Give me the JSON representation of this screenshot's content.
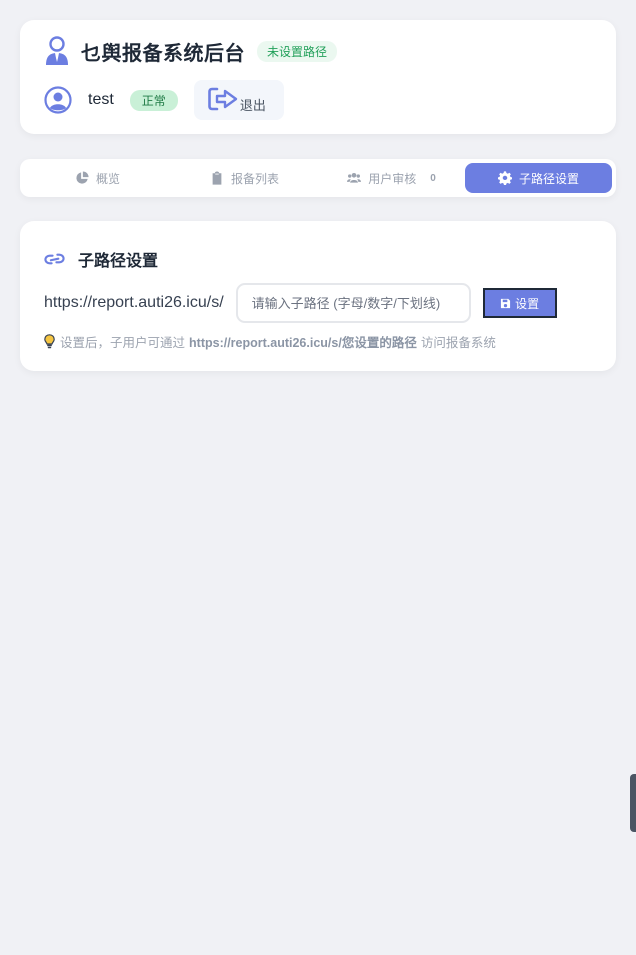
{
  "header": {
    "app_title": "乜舆报备系统后台",
    "path_badge": "未设置路径",
    "username": "test",
    "status": "正常",
    "logout_label": "退出"
  },
  "tabs": [
    {
      "label": "概览",
      "icon": "chart-pie-icon"
    },
    {
      "label": "报备列表",
      "icon": "clipboard-icon"
    },
    {
      "label": "用户审核",
      "icon": "users-icon",
      "count": "0"
    },
    {
      "label": "子路径设置",
      "icon": "gear-icon",
      "active": true
    }
  ],
  "subpath": {
    "section_title": "子路径设置",
    "base_url": "https://report.auti26.icu/s/",
    "input_value": "",
    "input_placeholder": "请输入子路径 (字母/数字/下划线)",
    "set_button_label": "设置",
    "hint_prefix": "设置后，子用户可通过",
    "hint_url": "https://report.auti26.icu/s/您设置的路径",
    "hint_suffix": "访问报备系统"
  },
  "colors": {
    "accent": "#6c7ee1",
    "background": "#f0f1f5",
    "success": "#22a05a"
  }
}
